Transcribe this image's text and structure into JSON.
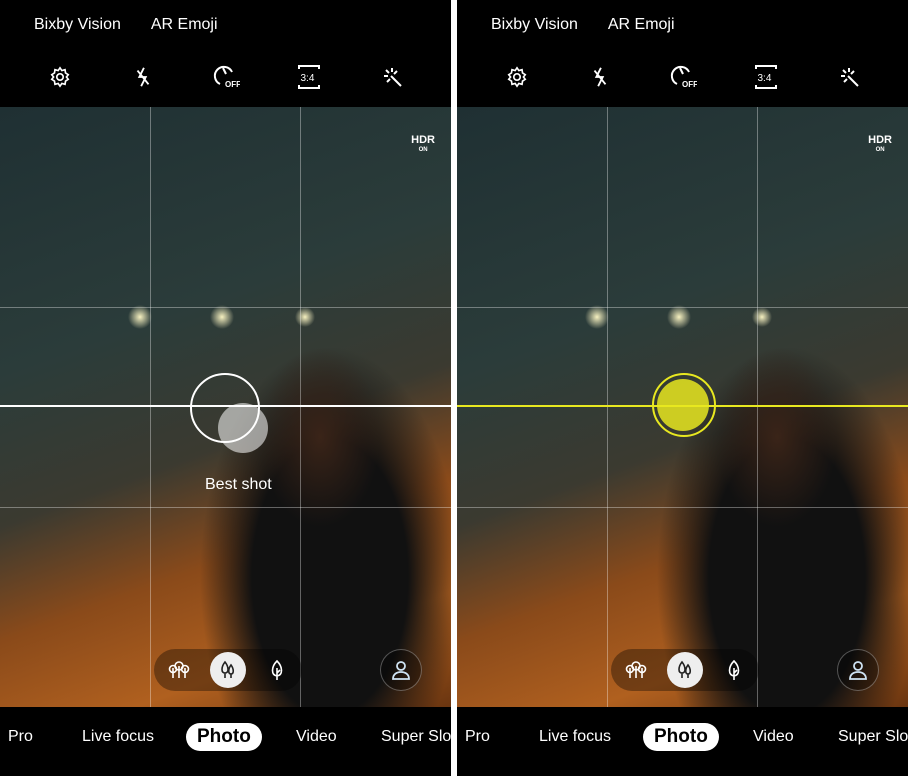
{
  "panels": [
    {
      "top_links": [
        "Bixby Vision",
        "AR Emoji"
      ],
      "hdr": "HDR",
      "hdr_state": "ON",
      "best_shot": "Best shot",
      "level_color": "#ffffff",
      "modes": [
        "Pro",
        "Live focus",
        "Photo",
        "Video",
        "Super Slo"
      ],
      "selected_mode": "Photo"
    },
    {
      "top_links": [
        "Bixby Vision",
        "AR Emoji"
      ],
      "hdr": "HDR",
      "hdr_state": "ON",
      "level_color": "#e8e820",
      "modes": [
        "Pro",
        "Live focus",
        "Photo",
        "Video",
        "Super Slo"
      ],
      "selected_mode": "Photo"
    }
  ],
  "toolbar_icons": [
    "gear-icon",
    "flash-off-icon",
    "timer-off-icon",
    "aspect-ratio-icon",
    "effects-wand-icon"
  ],
  "aspect_ratio": "3:4",
  "timer_state": "OFF",
  "effect_icons": [
    "forest-icon",
    "trees-icon",
    "leaf-icon"
  ],
  "selected_effect": "trees-icon"
}
